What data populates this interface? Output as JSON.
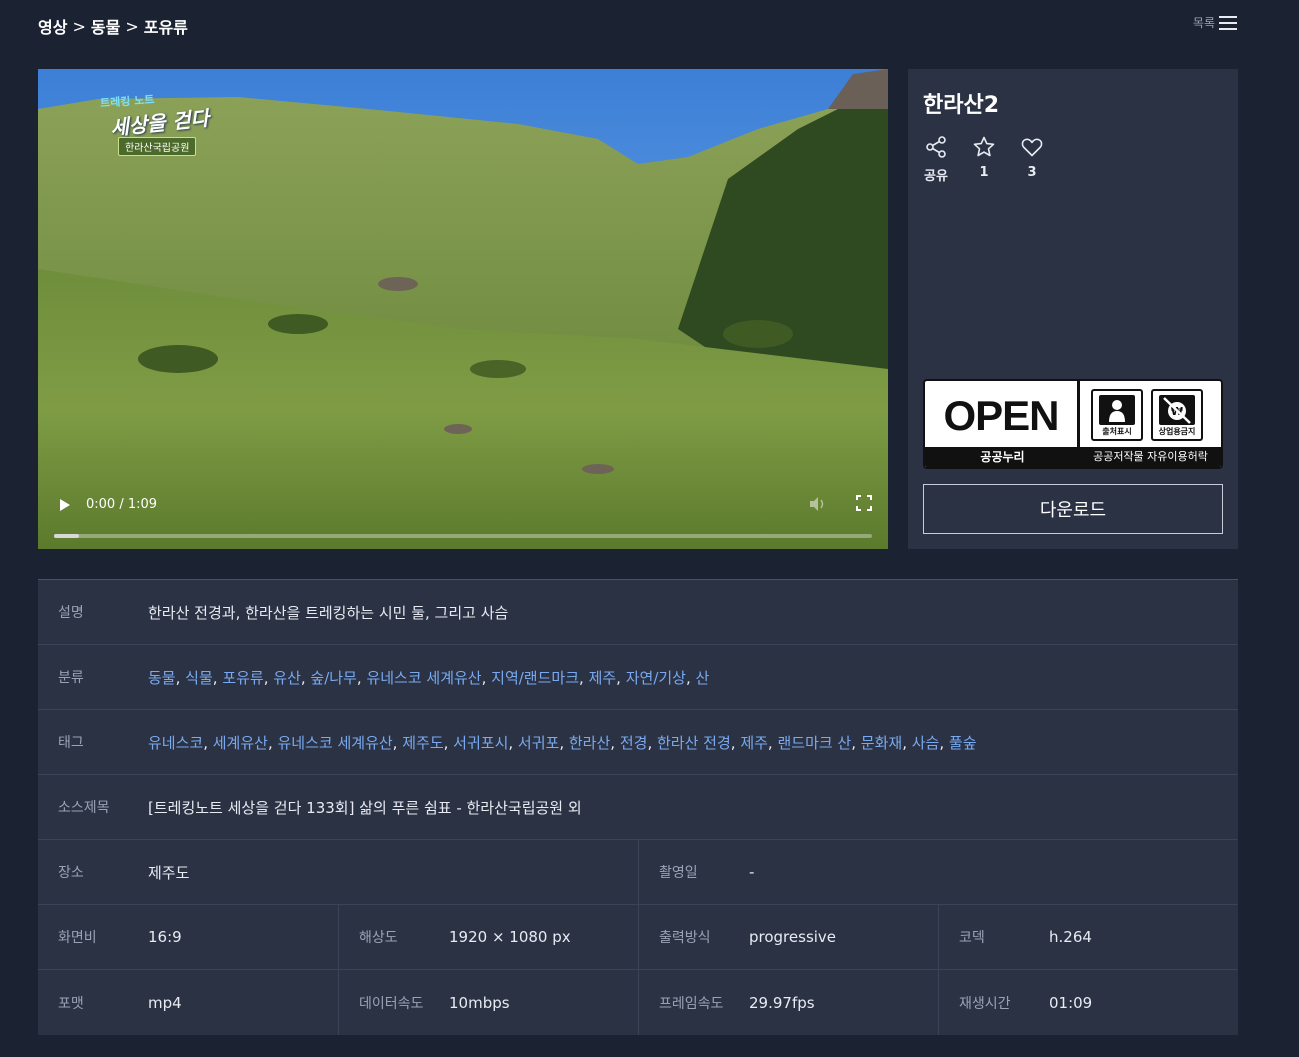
{
  "breadcrumb": {
    "items": [
      "영상",
      "동물",
      "포유류"
    ],
    "separator": ">"
  },
  "list_button": {
    "label": "목록"
  },
  "video": {
    "logo": {
      "line1": "트레킹 노트",
      "line2": "세상을 걷다",
      "badge": "한라산국립공원"
    },
    "time": "0:00 / 1:09",
    "progress": 0.03
  },
  "panel": {
    "title": "한라산2",
    "actions": [
      {
        "icon": "share-icon",
        "label": "공유"
      },
      {
        "icon": "star-icon",
        "label": "1"
      },
      {
        "icon": "heart-icon",
        "label": "3"
      }
    ],
    "license": {
      "word": "OPEN",
      "bottom_left": "공공누리",
      "bottom_right": "공공저작물 자유이용허락",
      "badge1": "출처표시",
      "badge2": "상업용금지"
    },
    "download_label": "다운로드"
  },
  "details": {
    "description": {
      "label": "설명",
      "value": "한라산 전경과, 한라산을 트레킹하는 시민 둘, 그리고 사슴"
    },
    "category": {
      "label": "분류",
      "items": [
        "동물",
        "식물",
        "포유류",
        "유산",
        "숲/나무",
        "유네스코 세계유산",
        "지역/랜드마크",
        "제주",
        "자연/기상",
        "산"
      ]
    },
    "tags": {
      "label": "태그",
      "items": [
        "유네스코",
        "세계유산",
        "유네스코 세계유산",
        "제주도",
        "서귀포시",
        "서귀포",
        "한라산",
        "전경",
        "한라산 전경",
        "제주",
        "랜드마크 산",
        "문화재",
        "사슴",
        "풀숲"
      ]
    },
    "source_title": {
      "label": "소스제목",
      "value": "[트레킹노트 세상을 걷다 133회] 삶의 푸른 쉼표 - 한라산국립공원 외"
    },
    "location": {
      "label": "장소",
      "value": "제주도"
    },
    "shoot_date": {
      "label": "촬영일",
      "value": "-"
    },
    "aspect": {
      "label": "화면비",
      "value": "16:9"
    },
    "resolution": {
      "label": "해상도",
      "value": "1920 × 1080 px"
    },
    "output": {
      "label": "출력방식",
      "value": "progressive"
    },
    "codec": {
      "label": "코덱",
      "value": "h.264"
    },
    "format": {
      "label": "포맷",
      "value": "mp4"
    },
    "bitrate": {
      "label": "데이터속도",
      "value": "10mbps"
    },
    "framerate": {
      "label": "프레임속도",
      "value": "29.97fps"
    },
    "duration": {
      "label": "재생시간",
      "value": "01:09"
    }
  }
}
